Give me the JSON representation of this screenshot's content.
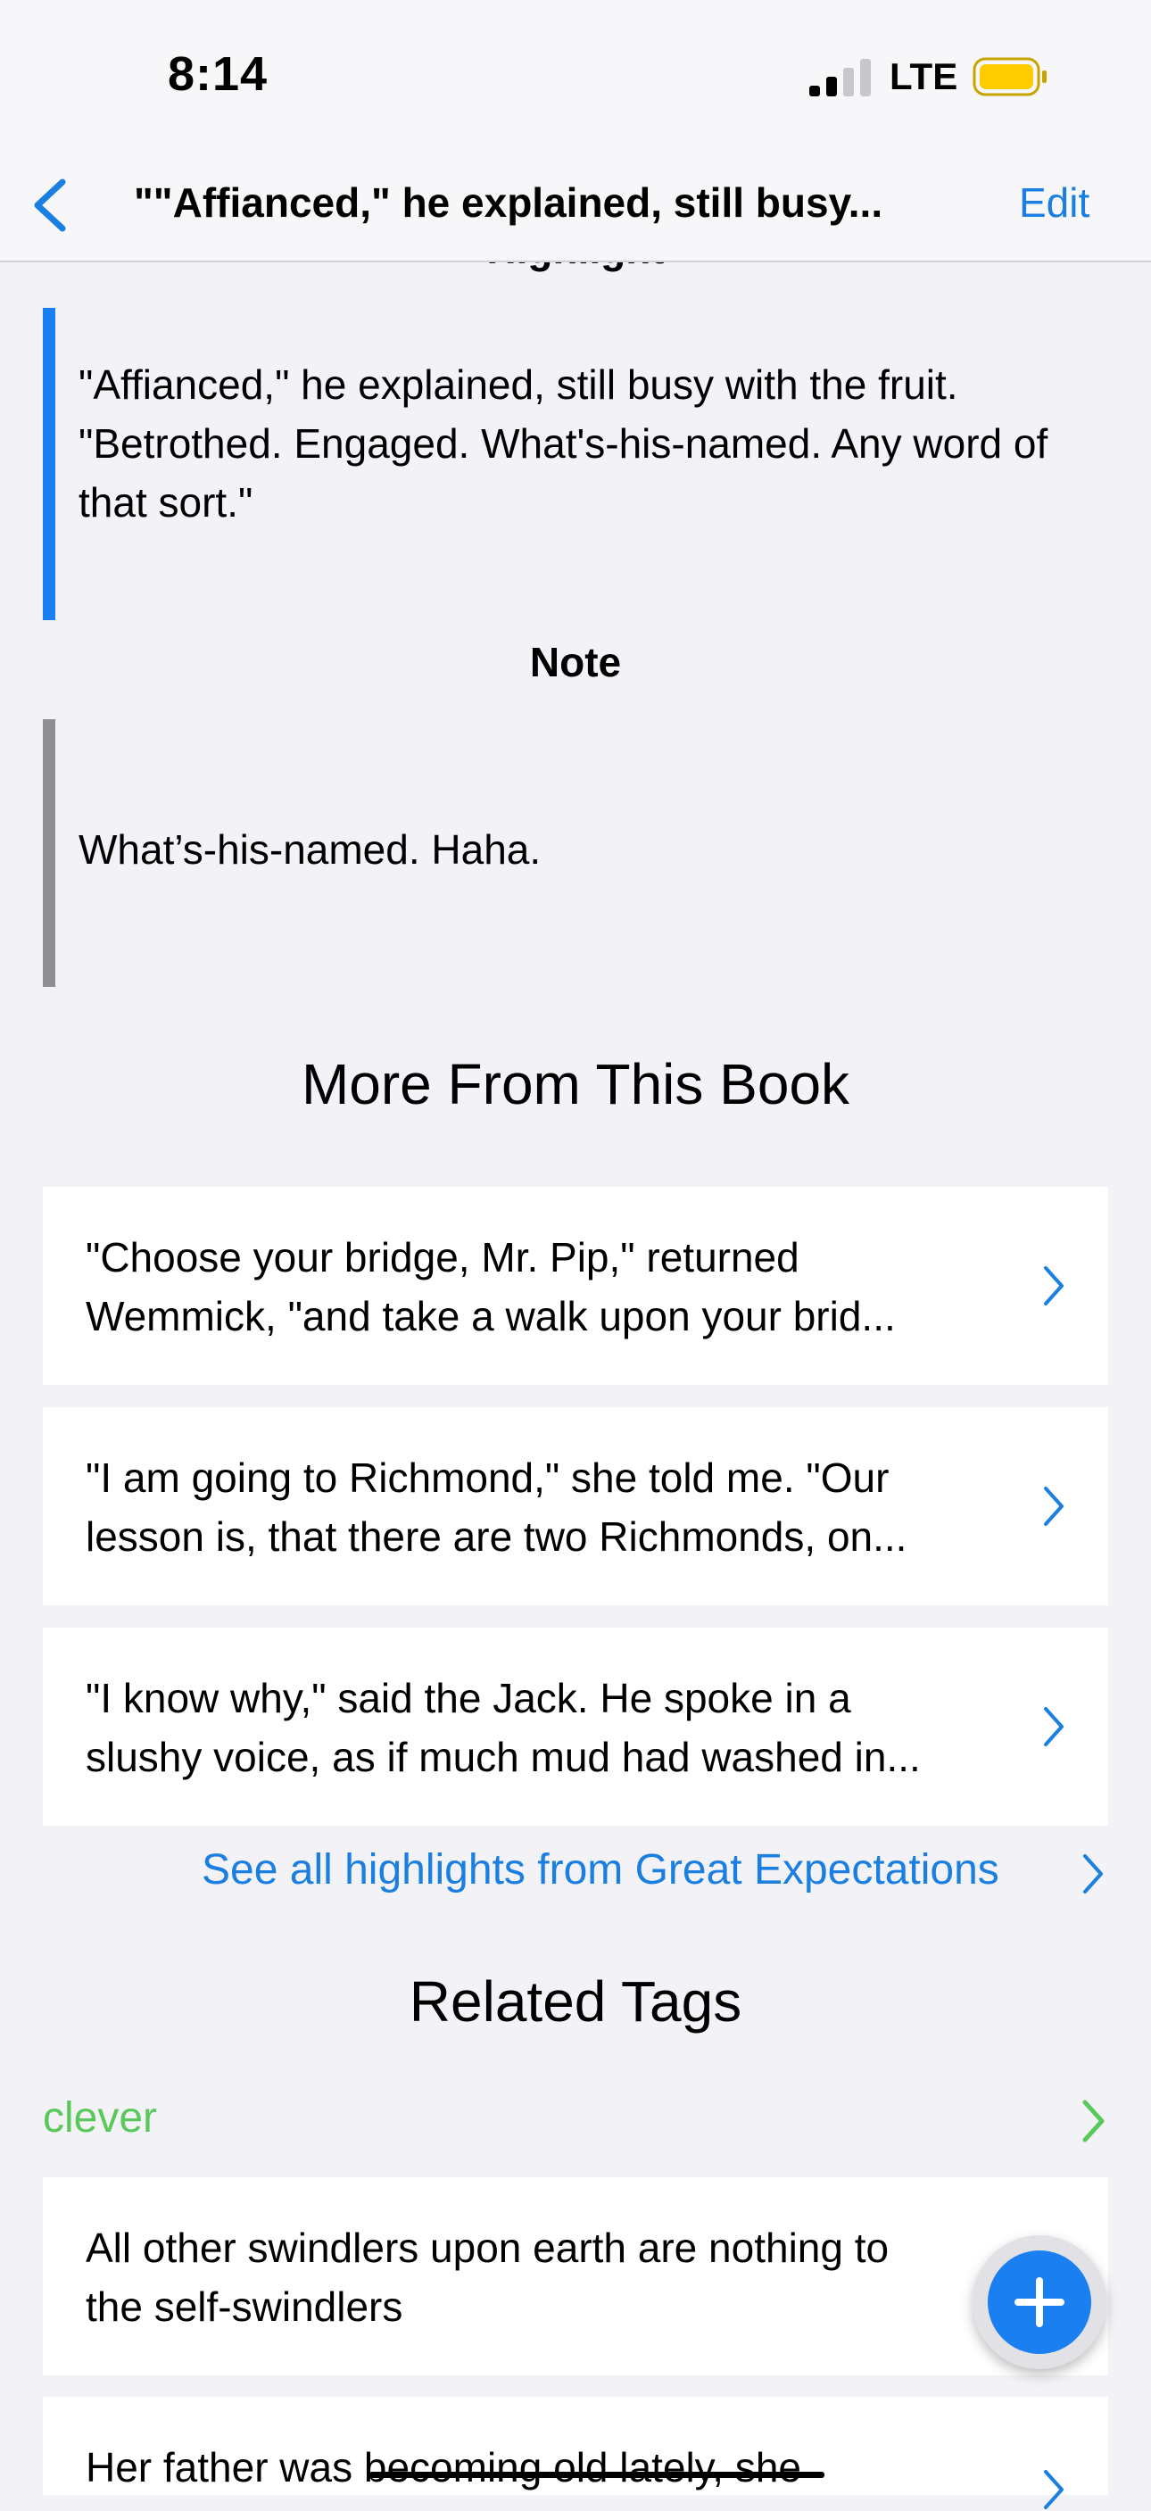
{
  "status_bar": {
    "time": "8:14",
    "network": "LTE"
  },
  "nav": {
    "title": "\"\"Affianced,\" he explained, still busy...",
    "edit_label": "Edit"
  },
  "highlight_heading": "Highlight",
  "highlight_text": "\"Affianced,\" he explained, still busy with the fruit. \"Betrothed. Engaged. What's-his-named. Any word of that sort.\"",
  "note_heading": "Note",
  "note_text": "What’s-his-named. Haha.",
  "more_section": {
    "title": "More From This Book",
    "items": [
      {
        "line1": "\"Choose your bridge, Mr. Pip,\" returned",
        "line2": "Wemmick, \"and take a walk upon your brid..."
      },
      {
        "line1": "\"I am going to Richmond,\" she told me. \"Our",
        "line2": "lesson is, that there are two Richmonds, on..."
      },
      {
        "line1": "\"I know why,\" said the Jack. He spoke in a",
        "line2": "slushy voice, as if much mud had washed in..."
      }
    ],
    "see_all_label": "See all highlights from Great Expectations"
  },
  "related_tags": {
    "title": "Related Tags",
    "tag": "clever",
    "tag_color": "#5ac85a",
    "items": [
      {
        "line1": "All other swindlers upon earth are nothing to",
        "line2": "the self-swindlers"
      },
      {
        "line1": "Her father was becoming old lately, she",
        "line2": ""
      }
    ]
  },
  "fab": {
    "icon": "plus-icon"
  },
  "colors": {
    "accent": "#1a7fe0",
    "background": "#f2f2f7",
    "battery": "#ffcc00"
  }
}
